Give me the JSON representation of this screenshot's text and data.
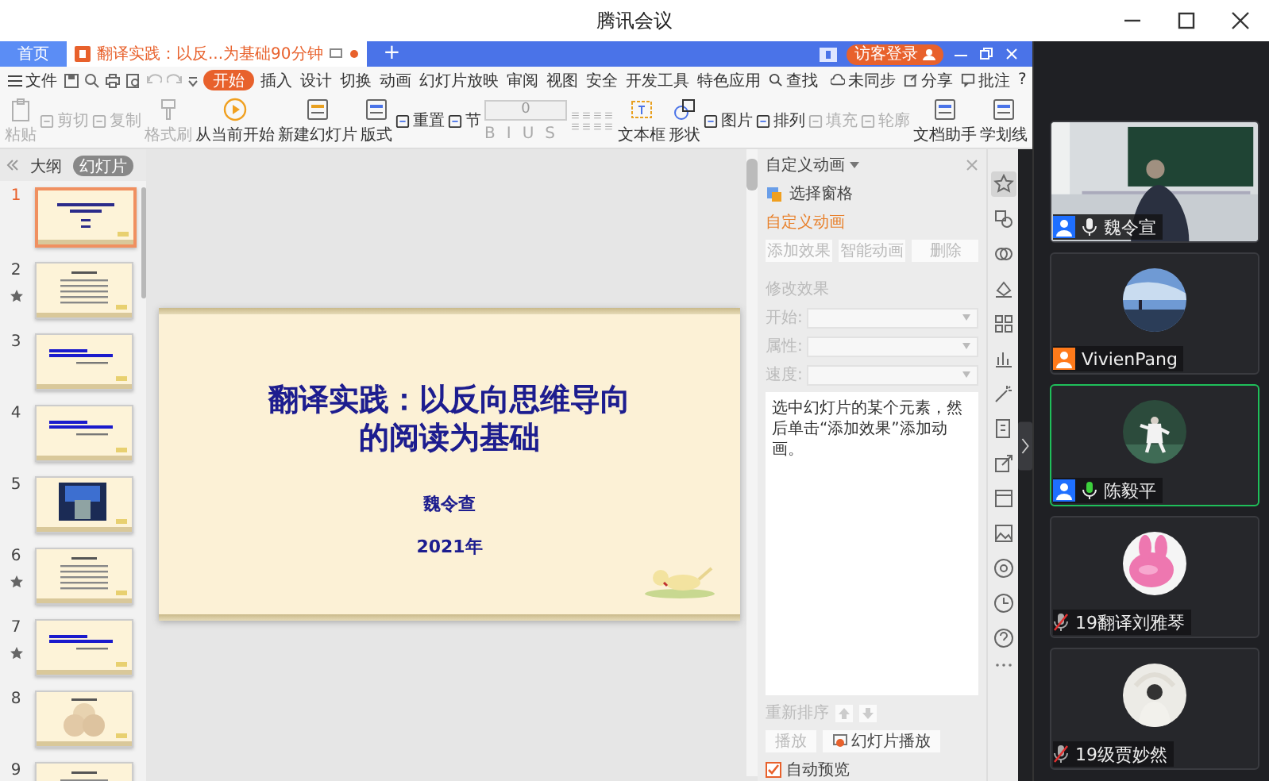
{
  "window": {
    "title": "腾讯会议"
  },
  "wps": {
    "tabs": [
      {
        "label": "首页",
        "kind": "home",
        "selected": false
      },
      {
        "label": "翻译实践：以反...为基础90分钟",
        "kind": "doc",
        "selected": true
      }
    ],
    "new_tab": "+",
    "login": "访客登录",
    "file_menu": "文件",
    "menu": [
      {
        "label": "开始",
        "selected": true
      },
      {
        "label": "插入",
        "selected": false
      },
      {
        "label": "设计",
        "selected": false
      },
      {
        "label": "切换",
        "selected": false
      },
      {
        "label": "动画",
        "selected": false
      },
      {
        "label": "幻灯片放映",
        "selected": false
      },
      {
        "label": "审阅",
        "selected": false
      },
      {
        "label": "视图",
        "selected": false
      },
      {
        "label": "安全",
        "selected": false
      },
      {
        "label": "开发工具",
        "selected": false
      },
      {
        "label": "特色应用",
        "selected": false
      }
    ],
    "search": "查找",
    "actions": [
      "未同步",
      "分享",
      "批注"
    ],
    "help": "?",
    "ribbon": [
      {
        "label": "粘贴",
        "kind": "large",
        "disabled": true
      },
      {
        "label": "剪切",
        "kind": "small",
        "disabled": true
      },
      {
        "label": "复制",
        "kind": "small",
        "disabled": true
      },
      {
        "label": "格式刷",
        "kind": "large",
        "disabled": true
      },
      {
        "label": "从当前开始",
        "kind": "large",
        "disabled": false
      },
      {
        "label": "新建幻灯片",
        "kind": "large",
        "disabled": false
      },
      {
        "label": "版式",
        "kind": "large",
        "disabled": false
      },
      {
        "label": "重置",
        "kind": "small",
        "disabled": false
      },
      {
        "label": "节",
        "kind": "small",
        "disabled": false
      },
      {
        "kind": "font",
        "value": "0",
        "disabled": true
      },
      {
        "label": "文本框",
        "kind": "large",
        "disabled": false
      },
      {
        "label": "形状",
        "kind": "large",
        "disabled": false
      },
      {
        "label": "图片",
        "kind": "small",
        "disabled": false
      },
      {
        "label": "排列",
        "kind": "small",
        "disabled": false
      },
      {
        "label": "填充",
        "kind": "small",
        "disabled": true
      },
      {
        "label": "轮廓",
        "kind": "small",
        "disabled": true
      },
      {
        "label": "文档助手",
        "kind": "large",
        "disabled": false
      },
      {
        "label": "学划线",
        "kind": "large",
        "disabled": false
      }
    ],
    "format_buttons": [
      "B",
      "I",
      "U",
      "S"
    ]
  },
  "slides_panel": {
    "tabs": [
      {
        "label": "大纲",
        "selected": false
      },
      {
        "label": "幻灯片",
        "selected": true
      }
    ],
    "thumbnails": [
      {
        "number": "1",
        "kind": "title",
        "selected": true,
        "animated": false
      },
      {
        "number": "2",
        "kind": "list",
        "selected": false,
        "animated": true
      },
      {
        "number": "3",
        "kind": "text",
        "selected": false,
        "animated": false
      },
      {
        "number": "4",
        "kind": "text",
        "selected": false,
        "animated": false
      },
      {
        "number": "5",
        "kind": "picture",
        "selected": false,
        "animated": false
      },
      {
        "number": "6",
        "kind": "list",
        "selected": false,
        "animated": true
      },
      {
        "number": "7",
        "kind": "text",
        "selected": false,
        "animated": true
      },
      {
        "number": "8",
        "kind": "diagram",
        "selected": false,
        "animated": false
      },
      {
        "number": "9",
        "kind": "list",
        "selected": false,
        "animated": false
      }
    ]
  },
  "slide": {
    "title_lines": [
      "翻译实践：以反向思维导向",
      "的阅读为基础"
    ],
    "author": "魏令查",
    "date": "2021年"
  },
  "animation_pane": {
    "title": "自定义动画",
    "selection_pane": "选择窗格",
    "section": "自定义动画",
    "buttons": [
      {
        "label": "添加效果",
        "disabled": true
      },
      {
        "label": "智能动画",
        "disabled": true
      },
      {
        "label": "删除",
        "disabled": true
      }
    ],
    "modify": "修改效果",
    "fields": [
      {
        "label": "开始:"
      },
      {
        "label": "属性:"
      },
      {
        "label": "速度:"
      }
    ],
    "hint": "选中幻灯片的某个元素，然后单击“添加效果”添加动画。",
    "reorder": "重新排序",
    "play": "播放",
    "slideshow": "幻灯片播放",
    "auto_preview": {
      "label": "自动预览",
      "checked": true
    }
  },
  "participants": [
    {
      "name": "魏令宣",
      "kind": "video",
      "badge": true,
      "color": "#1e6fff",
      "mic_muted": false,
      "speaking": false,
      "selected": false
    },
    {
      "name": "VivienPang",
      "kind": "avatar",
      "badge": true,
      "color": "#ff7a1a",
      "selected": false
    },
    {
      "name": "陈毅平",
      "kind": "avatar",
      "badge": true,
      "color": "#1e6fff",
      "mic_muted": false,
      "speaking": true,
      "selected": true
    },
    {
      "name": "19翻译刘雅琴",
      "kind": "avatar",
      "badge": false,
      "mic_muted": true,
      "speaking": false,
      "selected": false
    },
    {
      "name": "19级贾妙然",
      "kind": "avatar",
      "badge": false,
      "mic_muted": true,
      "speaking": false,
      "selected": false
    }
  ]
}
